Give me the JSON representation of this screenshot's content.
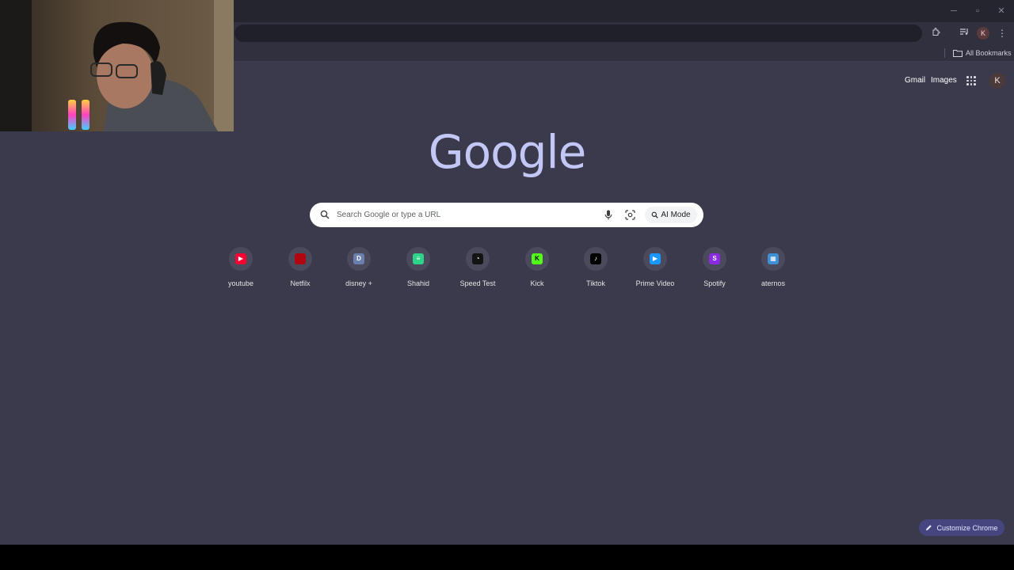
{
  "browser": {
    "window_controls": [
      "minimize-icon",
      "restore-icon",
      "close-icon"
    ],
    "toolbar_icons": [
      "extensions-icon",
      "media-control-icon",
      "more-menu-icon"
    ],
    "profile_initial": "K"
  },
  "bookmarks_bar": {
    "all_bookmarks_label": "All Bookmarks"
  },
  "ntp": {
    "header_links": {
      "gmail": "Gmail",
      "images": "Images"
    },
    "avatar_initial": "K",
    "logo_text": "Google",
    "search": {
      "placeholder": "Search Google or type a URL",
      "ai_mode_label": "AI Mode"
    },
    "shortcuts": [
      {
        "label": "youtube",
        "icon": "youtube-icon",
        "color": "#ff0033",
        "glyph": "▶"
      },
      {
        "label": "Netfilx",
        "icon": "netflix-icon",
        "color": "#b1060f",
        "glyph": ""
      },
      {
        "label": "disney +",
        "icon": "letter-d-icon",
        "color": "#6b7fae",
        "glyph": "D"
      },
      {
        "label": "Shahid",
        "icon": "shahid-icon",
        "color": "#2ed38a",
        "glyph": "≡"
      },
      {
        "label": "Speed Test",
        "icon": "speedometer-icon",
        "color": "#141414",
        "glyph": "◔"
      },
      {
        "label": "Kick",
        "icon": "kick-icon",
        "color": "#53fc18",
        "glyph": "K"
      },
      {
        "label": "Tiktok",
        "icon": "tiktok-icon",
        "color": "#000000",
        "glyph": "♪"
      },
      {
        "label": "Prime Video",
        "icon": "prime-video-icon",
        "color": "#1a98ff",
        "glyph": "▶"
      },
      {
        "label": "Spotify",
        "icon": "letter-s-icon",
        "color": "#8a2be2",
        "glyph": "S"
      },
      {
        "label": "aternos",
        "icon": "aternos-icon",
        "color": "#3f8fd6",
        "glyph": "▦"
      }
    ],
    "customize_label": "Customize Chrome"
  },
  "colors": {
    "page_background": "#3a3a4c",
    "logo": "#c2c7f6",
    "customize_button": "#454680"
  }
}
